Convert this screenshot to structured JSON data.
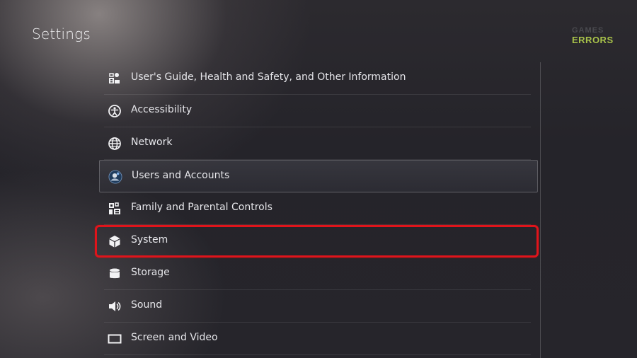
{
  "header": {
    "title": "Settings"
  },
  "watermark": {
    "line1": "GAMES",
    "line2": "ERRORS"
  },
  "menu": {
    "items": [
      {
        "label": "User's Guide, Health and Safety, and Other Information",
        "icon": "guide-icon"
      },
      {
        "label": "Accessibility",
        "icon": "accessibility-icon"
      },
      {
        "label": "Network",
        "icon": "globe-icon"
      },
      {
        "label": "Users and Accounts",
        "icon": "user-avatar-icon",
        "focused": true
      },
      {
        "label": "Family and Parental Controls",
        "icon": "family-icon"
      },
      {
        "label": "System",
        "icon": "cube-icon",
        "highlighted": true
      },
      {
        "label": "Storage",
        "icon": "storage-icon"
      },
      {
        "label": "Sound",
        "icon": "speaker-icon"
      },
      {
        "label": "Screen and Video",
        "icon": "screen-icon"
      }
    ]
  },
  "colors": {
    "highlight": "#e0141b",
    "brand_watermark": "#a8c24a"
  }
}
